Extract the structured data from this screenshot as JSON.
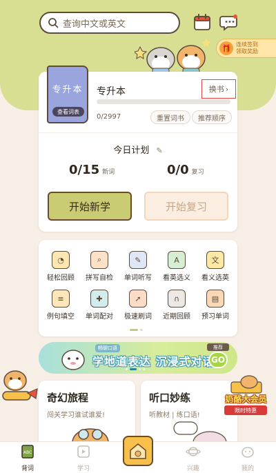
{
  "search": {
    "placeholder": "查询中文或英文"
  },
  "header_icons": [
    "calendar-icon",
    "chat-bubble-icon"
  ],
  "signin": {
    "line1": "连续签到",
    "line2": "领取奖励"
  },
  "book": {
    "cover_title": "专升本",
    "view_words_label": "查看词表",
    "name": "专升本",
    "change_label": "换书",
    "progress_text": "0/2997",
    "progress_fraction": 0.0,
    "reset_label": "重置词书",
    "recommend_order_label": "推荐顺序"
  },
  "plan": {
    "title": "今日计划",
    "new_value": "0/15",
    "new_label": "新词",
    "review_value": "0/0",
    "review_label": "复习",
    "start_learn_label": "开始新学",
    "start_review_label": "开始复习"
  },
  "tools": [
    {
      "label": "轻松回顾",
      "icon": "clock-face-icon"
    },
    {
      "label": "拼写自检",
      "icon": "magnifier-icon"
    },
    {
      "label": "单词听写",
      "icon": "clipboard-pen-icon"
    },
    {
      "label": "看英选义",
      "icon": "card-a-icon"
    },
    {
      "label": "看义选英",
      "icon": "card-wen-icon"
    },
    {
      "label": "例句填空",
      "icon": "notebook-icon"
    },
    {
      "label": "单词配对",
      "icon": "puzzle-icon"
    },
    {
      "label": "极速刷词",
      "icon": "rocket-icon"
    },
    {
      "label": "近期回顾",
      "icon": "headphones-icon"
    },
    {
      "label": "预习单词",
      "icon": "book-icon"
    }
  ],
  "banner": {
    "tag": "畅聊口语",
    "headline": "学地道表达 沉浸式对话",
    "badge_top": "推荐",
    "badge_main": "GO"
  },
  "features": [
    {
      "title": "奇幻旅程",
      "subtitle": "闯关学习谁试谁爱!"
    },
    {
      "title": "听口妙练",
      "subtitle": "听教材 | 练口语!"
    }
  ],
  "vip": {
    "title": "奶酪大会员",
    "subtitle": "限时特惠"
  },
  "tabbar": [
    {
      "label": "背词",
      "active": true
    },
    {
      "label": "学习",
      "active": false
    },
    {
      "label": "兴趣",
      "active": false
    },
    {
      "label": "我的",
      "active": false
    }
  ],
  "colors": {
    "header_green": "#d8df93",
    "background": "#f7efe6",
    "learn_button": "#c9cc73",
    "cover_blue": "#9aa4dd",
    "highlight_red": "#dd4444"
  }
}
